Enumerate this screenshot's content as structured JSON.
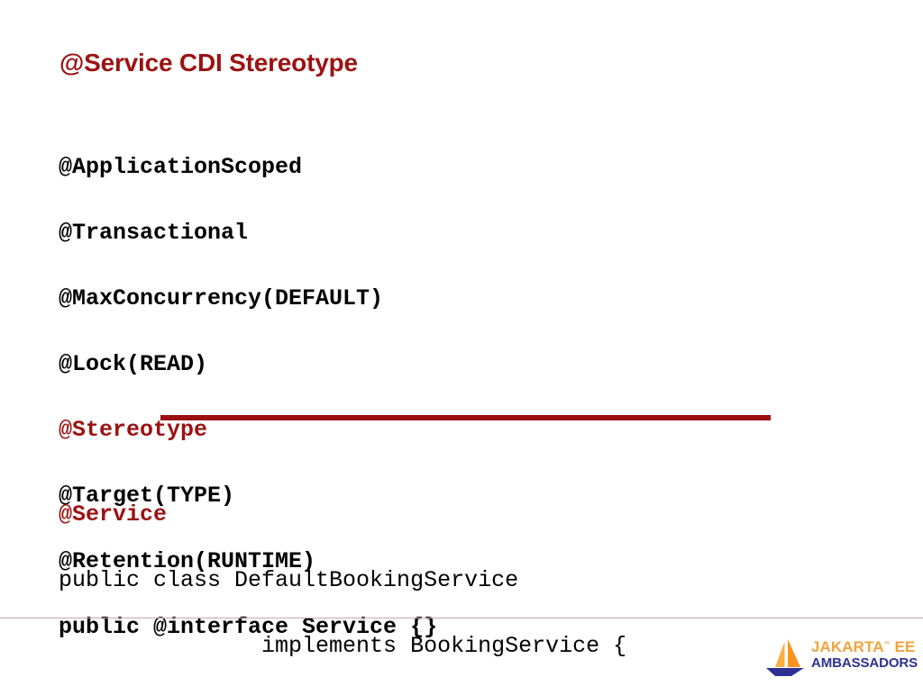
{
  "slide": {
    "title": "@Service CDI Stereotype",
    "background_color": "#ffffff",
    "accent_color": "#9c1212",
    "divider_color": "#9a1111",
    "footer_rule_color": "#c9a8b4"
  },
  "code_top": {
    "lines": [
      {
        "text": "@ApplicationScoped",
        "accent": false
      },
      {
        "text": "@Transactional",
        "accent": false
      },
      {
        "text": "@MaxConcurrency(DEFAULT)",
        "accent": false
      },
      {
        "text": "@Lock(READ)",
        "accent": false
      },
      {
        "text": "@Stereotype",
        "accent": true
      },
      {
        "text": "@Target(TYPE)",
        "accent": false
      },
      {
        "text": "@Retention(RUNTIME)",
        "accent": false
      },
      {
        "text": "public @interface Service {}",
        "accent": false
      }
    ]
  },
  "code_bottom": {
    "lines": [
      {
        "text": "@Service",
        "accent": true
      },
      {
        "text": "public class DefaultBookingService",
        "accent": false
      },
      {
        "text": "               implements BookingService {",
        "accent": false
      }
    ]
  },
  "footer": {
    "logo": {
      "icon_name": "sailboat-icon",
      "line1": "JAKARTA",
      "trademark": "™",
      "line1_suffix": " EE",
      "line2": "AMBASSADORS",
      "orange": "#f2a33c",
      "navy": "#2e3192"
    }
  }
}
